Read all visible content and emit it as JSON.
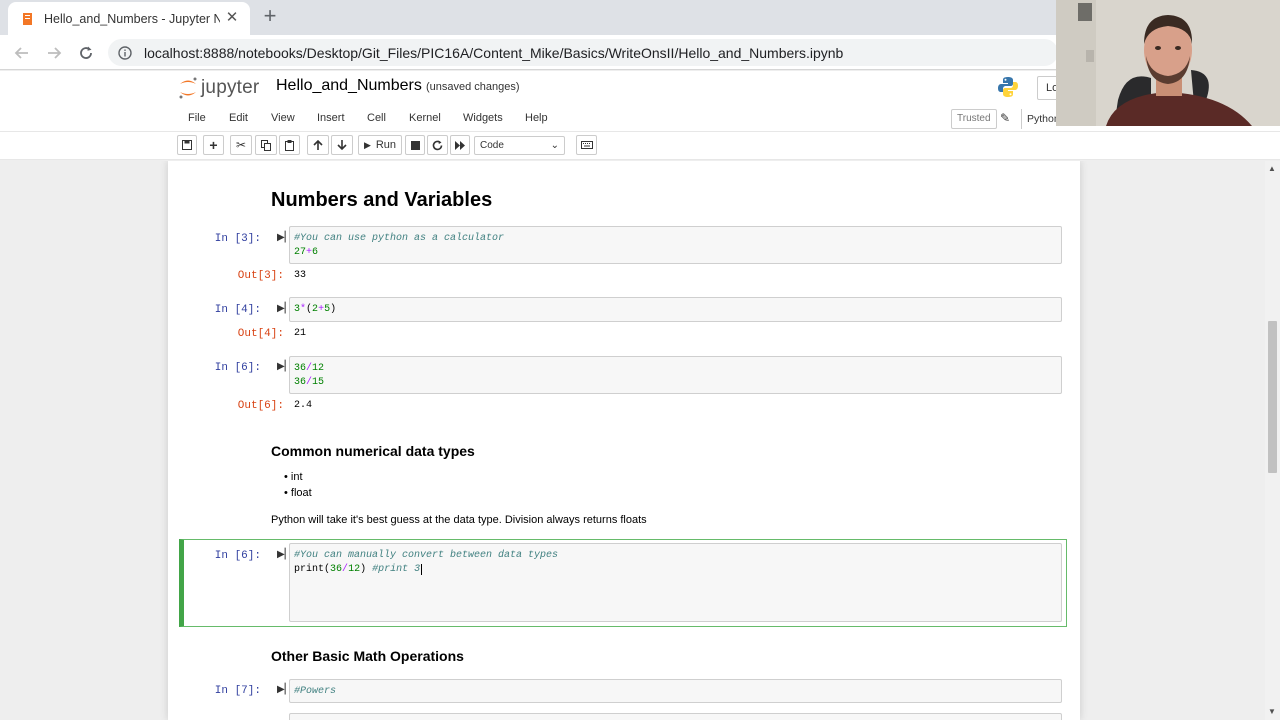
{
  "browser": {
    "tab_title": "Hello_and_Numbers - Jupyter Nc",
    "url": "localhost:8888/notebooks/Desktop/Git_Files/PIC16A/Content_Mike/Basics/WriteOnsII/Hello_and_Numbers.ipynb"
  },
  "jupyter": {
    "logo_text": "jupyter",
    "notebook_name": "Hello_and_Numbers",
    "save_status": "(unsaved changes)",
    "logout_label": "Lo",
    "menu": [
      "File",
      "Edit",
      "View",
      "Insert",
      "Cell",
      "Kernel",
      "Widgets",
      "Help"
    ],
    "trusted": "Trusted",
    "kernel_name": "Python",
    "toolbar": {
      "run_label": "Run",
      "cell_type": "Code"
    }
  },
  "notebook": {
    "heading_main": "Numbers and Variables",
    "cells": [
      {
        "in_prompt": "In [3]:",
        "lines": [
          "#You can use python as a calculator",
          "27+6"
        ],
        "out_prompt": "Out[3]:",
        "output": "33"
      },
      {
        "in_prompt": "In [4]:",
        "lines": [
          "3*(2+5)"
        ],
        "out_prompt": "Out[4]:",
        "output": "21"
      },
      {
        "in_prompt": "In [6]:",
        "lines": [
          "36/12",
          "36/15"
        ],
        "out_prompt": "Out[6]:",
        "output": "2.4"
      }
    ],
    "heading_types": "Common numerical data types",
    "types": [
      "int",
      "float"
    ],
    "types_note": "Python will take it's best guess at the data type. Division always returns floats",
    "active_cell": {
      "in_prompt": "In [6]:",
      "lines": [
        "#You can manually convert between data types",
        "print(36/12) #print 3"
      ]
    },
    "heading_ops": "Other Basic Math Operations",
    "next_cell": {
      "in_prompt": "In [7]:",
      "lines": [
        "#Powers"
      ]
    }
  },
  "colors": {
    "in_prompt": "#303f9f",
    "out_prompt": "#d84315",
    "comment": "#408080",
    "number": "#008000",
    "operator": "#aa22ff",
    "edit_border": "#42a548"
  }
}
